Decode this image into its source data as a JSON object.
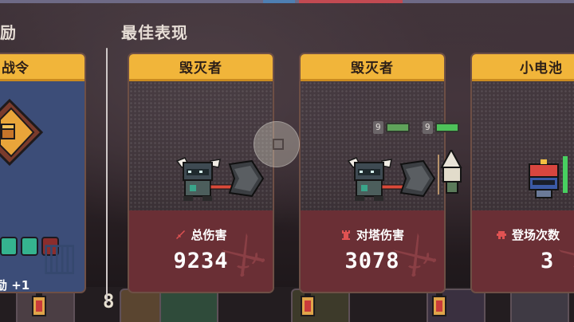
{
  "left_section": {
    "title_fragment": "励"
  },
  "best_section": {
    "title": "最佳表现"
  },
  "reward_card": {
    "header_fragment": "战令",
    "reward_text": "励 +1"
  },
  "cards": [
    {
      "header": "毁灭者",
      "stat_label": "总伤害",
      "stat_value": "9234",
      "stat_icon": "sword-icon"
    },
    {
      "header": "毁灭者",
      "stat_label": "对塔伤害",
      "stat_value": "3078",
      "stat_icon": "tower-icon"
    },
    {
      "header": "小电池",
      "stat_label": "登场次数",
      "stat_value": "3",
      "stat_icon": "deploy-icon"
    }
  ],
  "hp_tags": [
    {
      "level": "9"
    },
    {
      "level": "9"
    }
  ],
  "bottom_bar": {
    "left_count": "8"
  },
  "colors": {
    "card_header": "#f1b53a",
    "card_footer": "#6a2f35",
    "reward_bg": "#3c4d78",
    "stat_icon": "#d84a4a"
  }
}
